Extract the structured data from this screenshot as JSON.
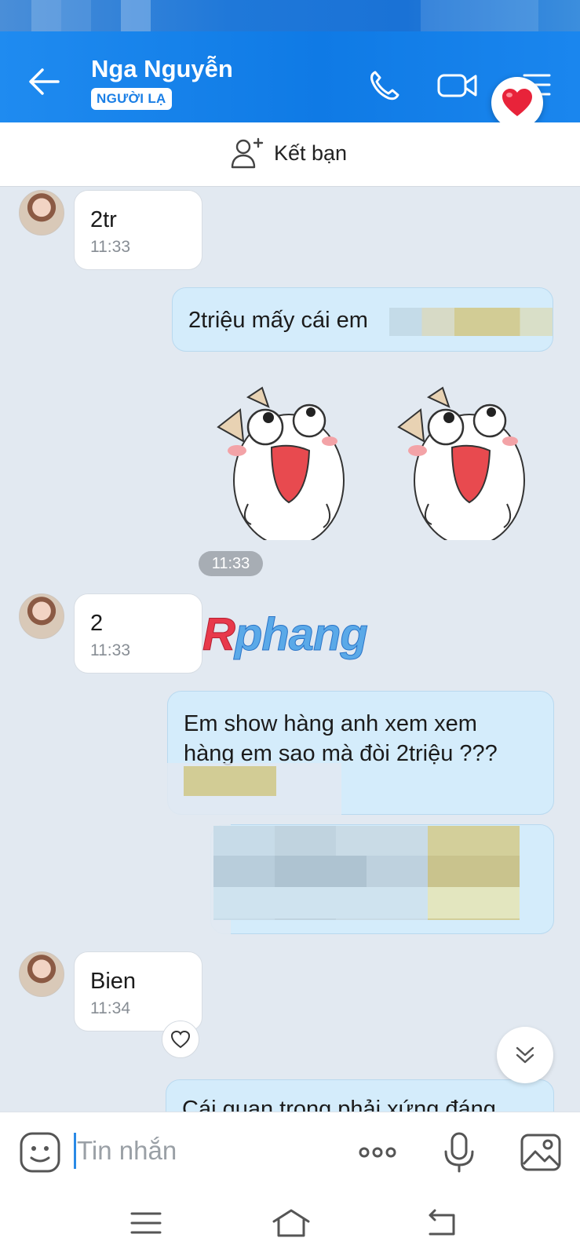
{
  "header": {
    "contact_name": "Nga Nguyễn",
    "badge": "NGƯỜI LẠ",
    "icons": [
      "back-arrow-icon",
      "phone-icon",
      "video-call-icon",
      "menu-icon",
      "heart-icon"
    ]
  },
  "add_friend": {
    "label": "Kết bạn",
    "icon": "add-person-icon"
  },
  "messages": [
    {
      "direction": "in",
      "text": "2tr",
      "time": "11:33"
    },
    {
      "direction": "out",
      "text": "2triệu mấy cái em"
    },
    {
      "direction": "out",
      "type": "sticker",
      "time": "11:33"
    },
    {
      "direction": "in",
      "text": "2",
      "time": "11:33"
    },
    {
      "direction": "out",
      "text_line1": "Em show hàng anh xem xem",
      "text_line2": "hàng em sao mà đòi 2triệu ???"
    },
    {
      "direction": "in",
      "text": "Bien",
      "time": "11:34"
    },
    {
      "direction": "out",
      "text": "Cái quan trọng phải xứng đáng"
    }
  ],
  "watermark": {
    "initial": "R",
    "rest": "phang"
  },
  "input": {
    "placeholder": "Tin nhắn"
  },
  "colors": {
    "header_blue": "#0f7ae5",
    "out_bubble": "#d4ecfb",
    "chat_bg": "#e2e9f1"
  }
}
